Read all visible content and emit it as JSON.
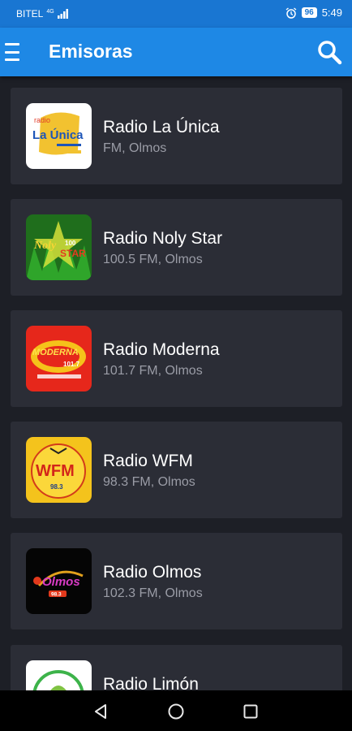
{
  "status_bar": {
    "carrier": "BITEL",
    "network": "4G",
    "battery": "96",
    "time": "5:49"
  },
  "app_bar": {
    "title": "Emisoras",
    "menu_icon": "hamburger-menu-icon",
    "search_icon": "search-icon"
  },
  "stations": [
    {
      "name": "Radio La Única",
      "meta": "FM, Olmos",
      "logo": "la-unica-logo"
    },
    {
      "name": "Radio Noly Star",
      "meta": "100.5 FM, Olmos",
      "logo": "noly-star-logo"
    },
    {
      "name": "Radio Moderna",
      "meta": "101.7 FM, Olmos",
      "logo": "moderna-logo"
    },
    {
      "name": "Radio WFM",
      "meta": "98.3 FM, Olmos",
      "logo": "wfm-logo"
    },
    {
      "name": "Radio Olmos",
      "meta": "102.3 FM, Olmos",
      "logo": "olmos-logo"
    },
    {
      "name": "Radio Limón",
      "meta": "",
      "logo": "limon-logo"
    }
  ],
  "logo_text": {
    "la_unica_top": "radio",
    "la_unica_main": "La Única",
    "noly_main": "Noly",
    "noly_freq": "100",
    "noly_star": "STAR",
    "moderna_main": "MODERNA",
    "moderna_freq": "101.7",
    "wfm_main": "WFM",
    "wfm_freq": "98.3",
    "olmos_main": "Olmos",
    "olmos_freq": "98.3"
  },
  "nav_bar": {
    "back_icon": "back-triangle-icon",
    "home_icon": "home-circle-icon",
    "recents_icon": "recents-square-icon"
  },
  "colors": {
    "status_bar": "#1976d2",
    "app_bar": "#1e88e5",
    "background": "#1d1f26",
    "card": "#2b2d36",
    "secondary_text": "#9a9ca6"
  }
}
